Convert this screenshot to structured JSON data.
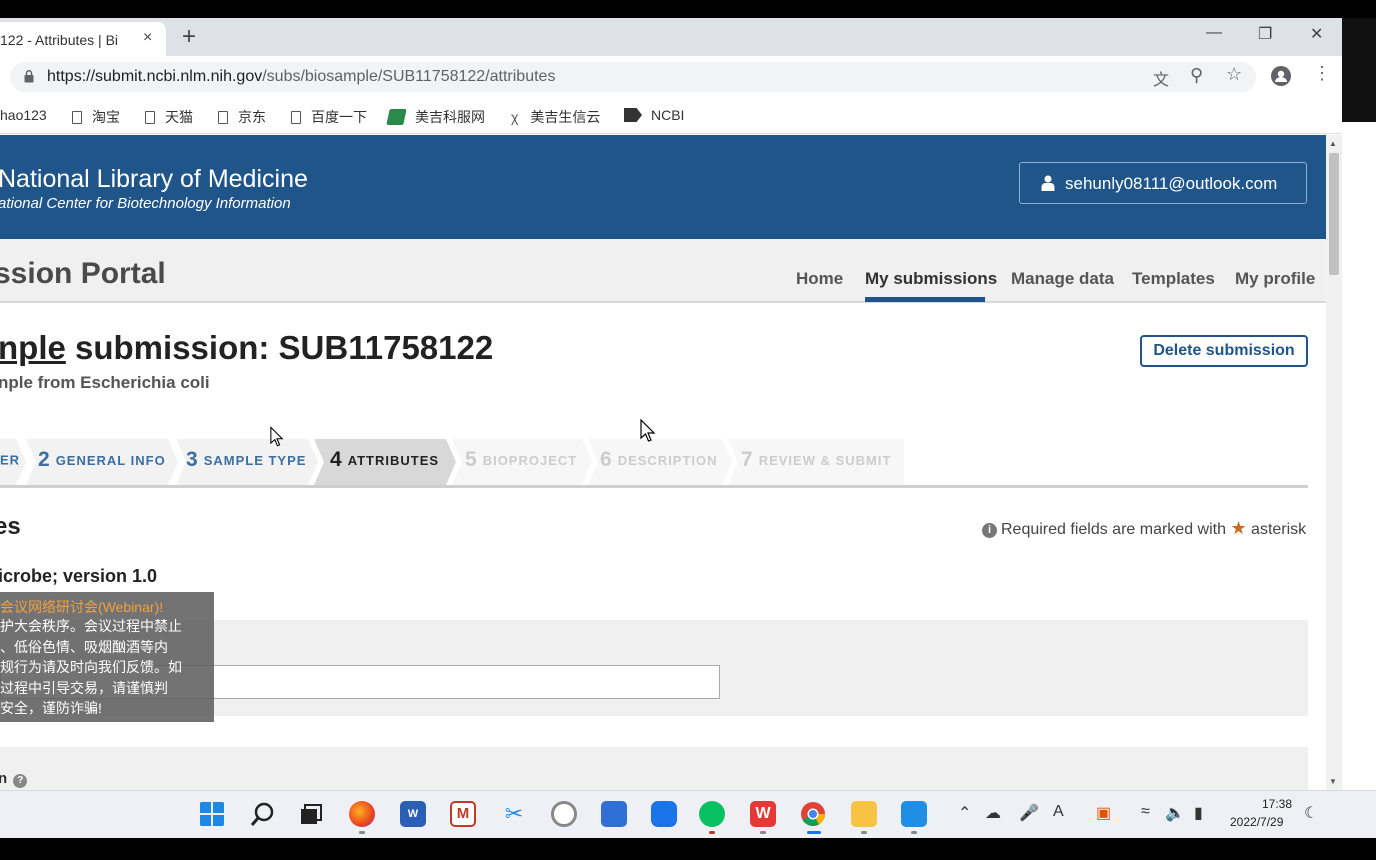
{
  "browser": {
    "tab_title": "122 - Attributes | Bi",
    "tab_close": "×",
    "new_tab": "+",
    "url_host": "https://submit.ncbi.nlm.nih.gov",
    "url_path": "/subs/biosample/SUB11758122/attributes",
    "bookmarks": [
      "hao123",
      "淘宝",
      "天猫",
      "京东",
      "百度一下",
      "美吉科服网",
      "美吉生信云",
      "NCBI"
    ]
  },
  "header": {
    "title": "National Library of Medicine",
    "subtitle": "ational Center for Biotechnology Information",
    "account": "sehunly08111@outlook.com"
  },
  "portal": {
    "title": "ssion Portal",
    "nav": [
      "Home",
      "My submissions",
      "Manage data",
      "Templates",
      "My profile"
    ],
    "active_nav": "My submissions"
  },
  "submission": {
    "title_prefix": "nple",
    "title_rest": " submission: SUB11758122",
    "description": "nple from Escherichia coli",
    "delete_label": "Delete submission"
  },
  "steps": [
    {
      "num": "",
      "label": "ER",
      "state": "done"
    },
    {
      "num": "2",
      "label": "GENERAL INFO",
      "state": "done"
    },
    {
      "num": "3",
      "label": "SAMPLE TYPE",
      "state": "done"
    },
    {
      "num": "4",
      "label": "ATTRIBUTES",
      "state": "current"
    },
    {
      "num": "5",
      "label": "BIOPROJECT",
      "state": "future"
    },
    {
      "num": "6",
      "label": "DESCRIPTION",
      "state": "future"
    },
    {
      "num": "7",
      "label": "REVIEW & SUBMIT",
      "state": "future"
    }
  ],
  "attributes": {
    "heading": "es",
    "required_note_pre": "Required fields are marked with",
    "required_note_post": "asterisk",
    "package": "icrobe; version 1.0",
    "field2_label": "n"
  },
  "notice": {
    "title": "会议网络研讨会(Webinar)!",
    "lines": [
      "护大会秩序。会议过程中禁止",
      "、低俗色情、吸烟酗酒等内",
      "规行为请及时向我们反馈。如",
      "过程中引导交易，请谨慎判",
      "安全，谨防诈骗!"
    ]
  },
  "taskbar": {
    "time": "17:38",
    "date": "2022/7/29"
  },
  "colors": {
    "nlm_blue": "#20558a",
    "step_done": "#3a6fa3",
    "asterisk": "#c86a1f"
  }
}
